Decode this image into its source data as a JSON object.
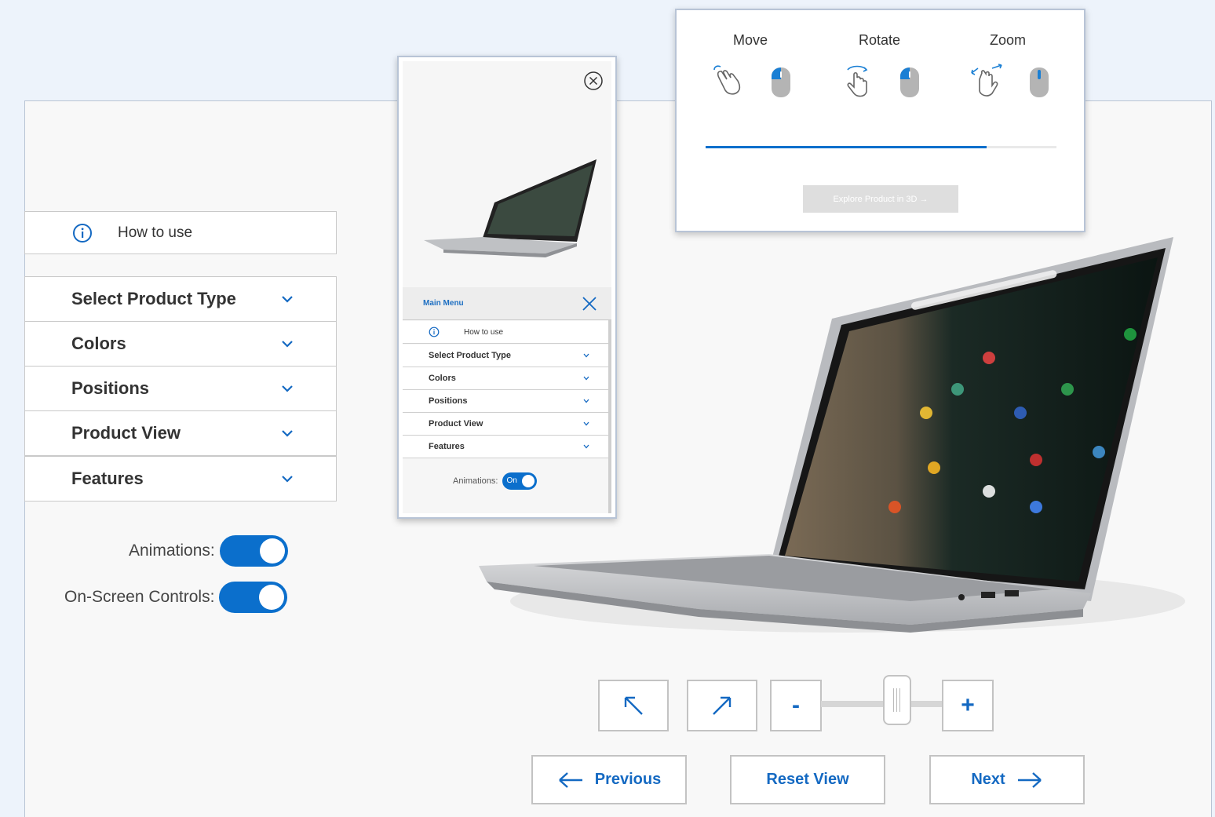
{
  "sidebar": {
    "how_to_use": "How to use",
    "items": [
      {
        "label": "Select Product Type"
      },
      {
        "label": "Colors"
      },
      {
        "label": "Positions"
      },
      {
        "label": "Product View"
      },
      {
        "label": "Features"
      }
    ],
    "animations_label": "Animations:",
    "onscreen_controls_label": "On-Screen Controls:"
  },
  "mobile_menu": {
    "title": "Main Menu",
    "how_to_use": "How to use",
    "items": [
      {
        "label": "Select Product Type"
      },
      {
        "label": "Colors"
      },
      {
        "label": "Positions"
      },
      {
        "label": "Product View"
      },
      {
        "label": "Features"
      }
    ],
    "animations_label": "Animations:",
    "animations_state": "On"
  },
  "controls_help": {
    "move": "Move",
    "rotate": "Rotate",
    "zoom": "Zoom",
    "progress": 0.8,
    "explore_label": "Explore Product in 3D →"
  },
  "bottom_controls": {
    "zoom_out": "-",
    "zoom_in": "+",
    "zoom_level": 0.62,
    "previous": "Previous",
    "reset": "Reset View",
    "next": "Next"
  },
  "colors": {
    "accent": "#0b6fcc",
    "border": "#c3c3c3"
  }
}
